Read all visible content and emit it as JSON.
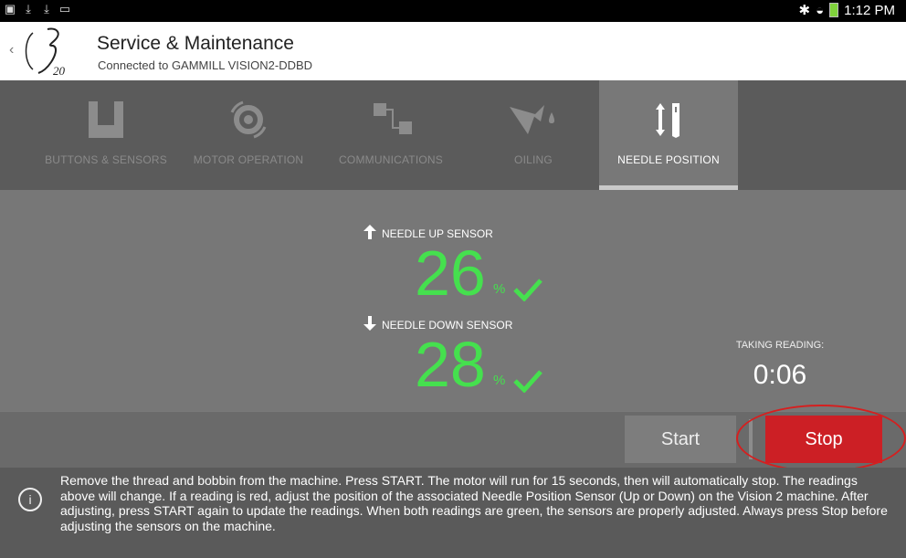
{
  "status_bar": {
    "left_icons": [
      "gallery-icon",
      "download-icon",
      "download-icon",
      "cast-icon"
    ],
    "right_icons": [
      "bluetooth-icon",
      "wifi-icon",
      "battery-icon"
    ],
    "time": "1:12 PM"
  },
  "header": {
    "logo_text": "20",
    "title": "Service & Maintenance",
    "subtitle": "Connected to GAMMILL VISION2-DDBD"
  },
  "tabs": [
    {
      "label": "BUTTONS & SENSORS",
      "icon": "buttons-sensors-icon",
      "active": false
    },
    {
      "label": "MOTOR OPERATION",
      "icon": "motor-gear-icon",
      "active": false
    },
    {
      "label": "COMMUNICATIONS",
      "icon": "communications-icon",
      "active": false
    },
    {
      "label": "OILING",
      "icon": "oil-can-icon",
      "active": false
    },
    {
      "label": "NEEDLE POSITION",
      "icon": "needle-position-icon",
      "active": true
    }
  ],
  "sensors": {
    "up": {
      "label": "NEEDLE UP SENSOR",
      "value": "26",
      "unit": "%",
      "status": "ok"
    },
    "down": {
      "label": "NEEDLE DOWN SENSOR",
      "value": "28",
      "unit": "%",
      "status": "ok"
    }
  },
  "reading": {
    "label": "TAKING READING:",
    "time": "0:06"
  },
  "actions": {
    "start_label": "Start",
    "stop_label": "Stop"
  },
  "info": {
    "text": "Remove the thread and bobbin from the machine. Press START. The motor will run for 15 seconds, then will automatically stop. The readings above will change. If a reading is red, adjust the position of the associated Needle Position Sensor (Up or Down) on the Vision 2 machine. After adjusting, press START again to update the readings. When both readings are green, the sensors are properly adjusted. Always press Stop before adjusting the sensors on the machine."
  },
  "colors": {
    "ok_green": "#45e04e",
    "stop_red": "#cc1f25",
    "highlight_red": "#d61f1f"
  }
}
